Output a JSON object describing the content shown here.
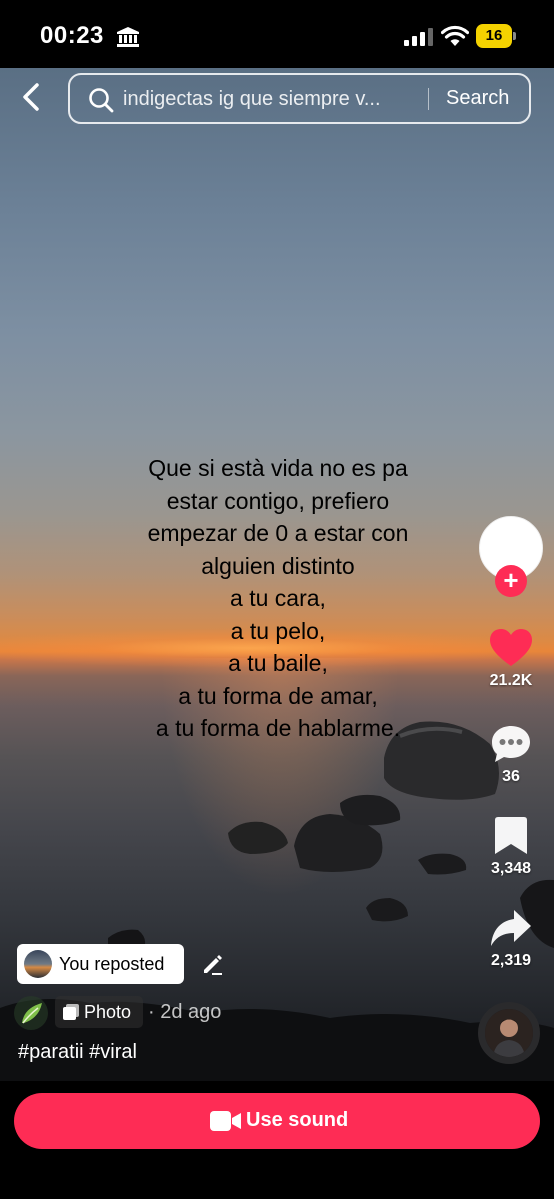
{
  "status_bar": {
    "time": "00:23",
    "battery": "16",
    "icons": [
      "bank-icon",
      "signal-icon",
      "wifi-icon",
      "battery-icon"
    ]
  },
  "header": {
    "search_query": "indigectas ig que siempre v...",
    "search_button": "Search"
  },
  "post": {
    "overlay_lines": [
      "Que si està vida no es pa",
      "estar contigo, prefiero",
      "empezar de 0 a estar con",
      "alguien distinto",
      "a tu cara,",
      "a tu pelo,",
      "a tu baile,",
      "a tu forma de amar,",
      "a tu forma de hablarme."
    ],
    "repost_label": "You reposted",
    "content_type": "Photo",
    "time_ago": "· 2d ago",
    "hashtags": "#paratii #viral"
  },
  "actions": {
    "likes": "21.2K",
    "comments": "36",
    "saves": "3,348",
    "shares": "2,319"
  },
  "bottom": {
    "use_sound_label": "Use sound"
  },
  "colors": {
    "accent": "#fe2c55",
    "battery": "#f4d200"
  }
}
